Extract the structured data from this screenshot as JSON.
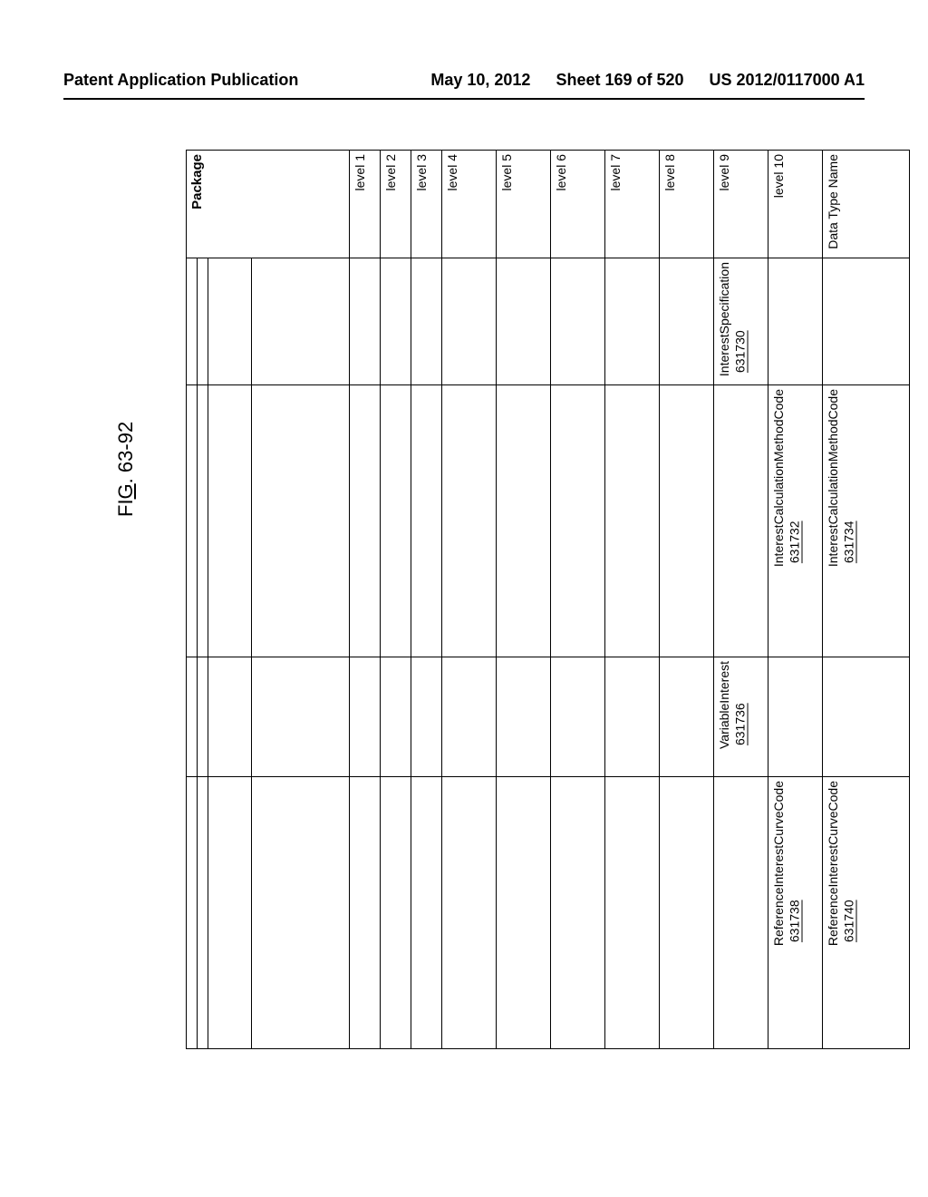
{
  "header": {
    "left": "Patent Application Publication",
    "date": "May 10, 2012",
    "sheet": "Sheet 169 of 520",
    "pubno": "US 2012/0117000 A1"
  },
  "figure_label_prefix": "FI",
  "figure_label_letter": "G",
  "figure_label_suffix": ". 63-92",
  "columns": {
    "package": "Package",
    "level1": "level 1",
    "level2": "level 2",
    "level3": "level 3",
    "level4": "level 4",
    "level5": "level 5",
    "level6": "level 6",
    "level7": "level 7",
    "level8": "level 8",
    "level9": "level 9",
    "level10": "level 10",
    "datatype": "Data Type Name"
  },
  "rows": [
    {
      "level9": {
        "text": "InterestSpecification",
        "ref": "631730"
      }
    },
    {
      "level10": {
        "text": "InterestCalculationMethodCode",
        "ref": "631732"
      },
      "datatype": {
        "text": "InterestCalculationMethodCode",
        "ref": "631734"
      }
    },
    {
      "level9": {
        "text": "VariableInterest",
        "ref": "631736"
      }
    },
    {
      "level10": {
        "text": "ReferenceInterestCurveCode",
        "ref": "631738"
      },
      "datatype": {
        "text": "ReferenceInterestCurveCode",
        "ref": "631740"
      }
    }
  ]
}
